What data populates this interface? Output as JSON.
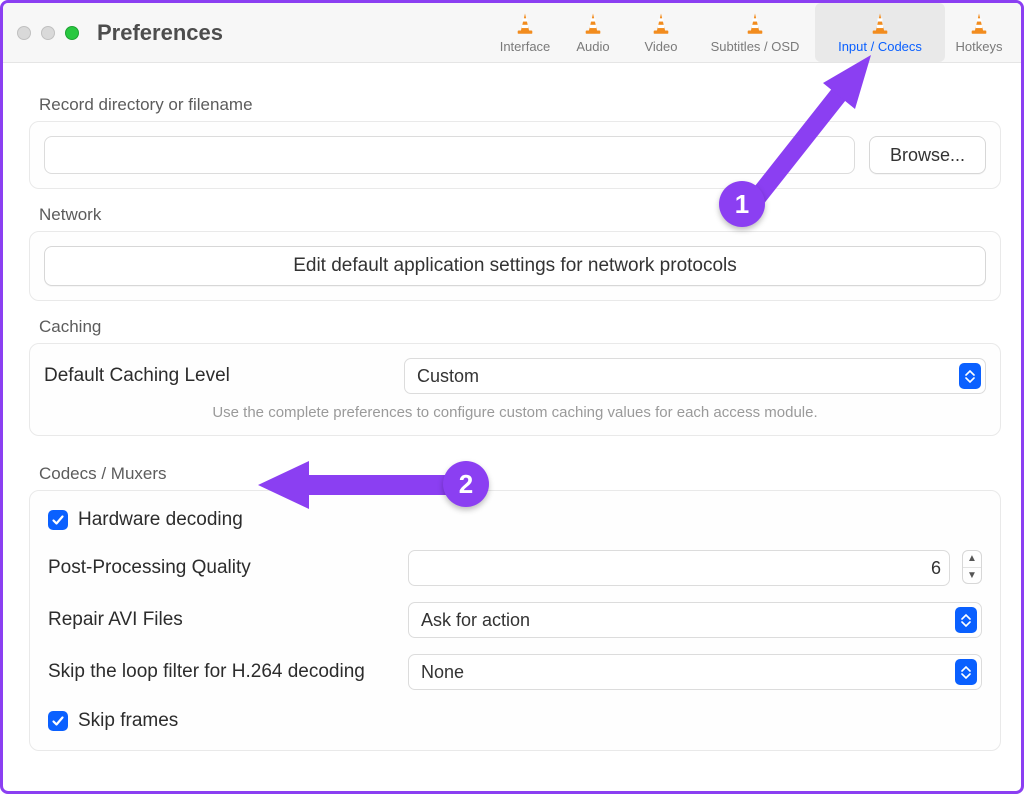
{
  "window": {
    "title": "Preferences"
  },
  "tabs": {
    "interface": "Interface",
    "audio": "Audio",
    "video": "Video",
    "subtitles": "Subtitles / OSD",
    "input_codecs": "Input / Codecs",
    "hotkeys": "Hotkeys"
  },
  "sections": {
    "record": {
      "label": "Record directory or filename",
      "browse": "Browse..."
    },
    "network": {
      "label": "Network",
      "button": "Edit default application settings for network protocols"
    },
    "caching": {
      "label": "Caching",
      "default_level_label": "Default Caching Level",
      "default_level_value": "Custom",
      "hint": "Use the complete preferences to configure custom caching values for each access module."
    },
    "codecs": {
      "label": "Codecs / Muxers",
      "hardware_decoding": "Hardware decoding",
      "post_processing_label": "Post-Processing Quality",
      "post_processing_value": "6",
      "repair_avi_label": "Repair AVI Files",
      "repair_avi_value": "Ask for action",
      "skip_loop_label": "Skip the loop filter for H.264 decoding",
      "skip_loop_value": "None",
      "skip_frames": "Skip frames"
    }
  },
  "annotations": {
    "step1": "1",
    "step2": "2"
  }
}
